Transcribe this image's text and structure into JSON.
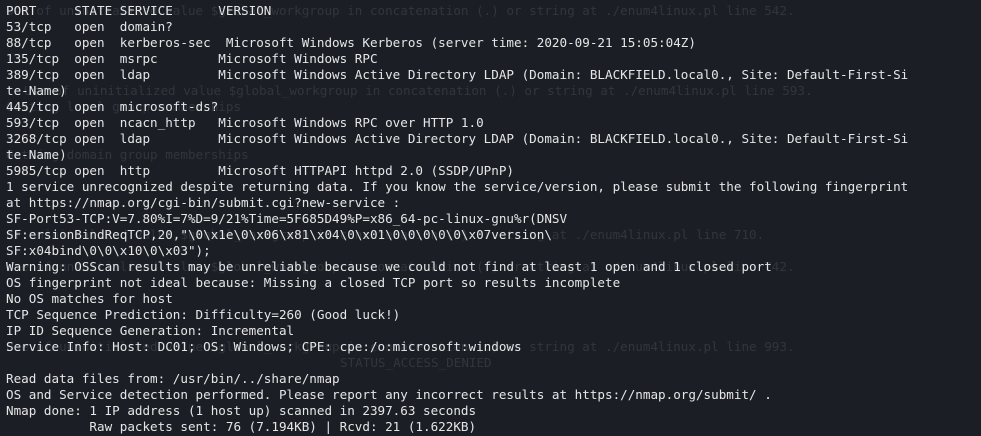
{
  "ghost_lines": [
    "Use of uninitialized value $global_workgroup in concatenation (.) or string at ./enum4linux.pl line 542.",
    "Getting local group memberships",
    "Use of uninitialized value $global_workgroup in concatenation (.) or string at ./enum4linux.pl line 593.",
    "Getting domain group memberships",
    "of uninitialized value $global_workgroup in concatenation (.) or string at ./enum4linux.pl line 710.",
    "Use of uninitialized value $global_workgroup in concatenation (.) or string at ./enum4linux.pl line 742.",
    "Use of uninitialized value $global_workgroup in concatenation (.) or string at ./enum4linux.pl line 993.",
    "STATUS_ACCESS_DENIED"
  ],
  "lines": [
    "PORT     STATE SERVICE      VERSION",
    "53/tcp   open  domain?",
    "88/tcp   open  kerberos-sec  Microsoft Windows Kerberos (server time: 2020-09-21 15:05:04Z)",
    "135/tcp  open  msrpc        Microsoft Windows RPC",
    "389/tcp  open  ldap         Microsoft Windows Active Directory LDAP (Domain: BLACKFIELD.local0., Site: Default-First-Si",
    "te-Name)",
    "445/tcp  open  microsoft-ds?",
    "593/tcp  open  ncacn_http   Microsoft Windows RPC over HTTP 1.0",
    "3268/tcp open  ldap         Microsoft Windows Active Directory LDAP (Domain: BLACKFIELD.local0., Site: Default-First-Si",
    "te-Name)",
    "5985/tcp open  http         Microsoft HTTPAPI httpd 2.0 (SSDP/UPnP)",
    "1 service unrecognized despite returning data. If you know the service/version, please submit the following fingerprint",
    "at https://nmap.org/cgi-bin/submit.cgi?new-service :",
    "SF-Port53-TCP:V=7.80%I=7%D=9/21%Time=5F685D49%P=x86_64-pc-linux-gnu%r(DNSV",
    "SF:ersionBindReqTCP,20,\"\\0\\x1e\\0\\x06\\x81\\x04\\0\\x01\\0\\0\\0\\0\\0\\x07version\\",
    "SF:x04bind\\0\\0\\x10\\0\\x03\");",
    "Warning: OSScan results may be unreliable because we could not find at least 1 open and 1 closed port",
    "OS fingerprint not ideal because: Missing a closed TCP port so results incomplete",
    "No OS matches for host",
    "TCP Sequence Prediction: Difficulty=260 (Good luck!)",
    "IP ID Sequence Generation: Incremental",
    "Service Info: Host: DC01; OS: Windows; CPE: cpe:/o:microsoft:windows",
    "",
    "Read data files from: /usr/bin/../share/nmap",
    "OS and Service detection performed. Please report any incorrect results at https://nmap.org/submit/ .",
    "Nmap done: 1 IP address (1 host up) scanned in 2397.63 seconds",
    "           Raw packets sent: 76 (7.194KB) | Rcvd: 21 (1.622KB)"
  ]
}
